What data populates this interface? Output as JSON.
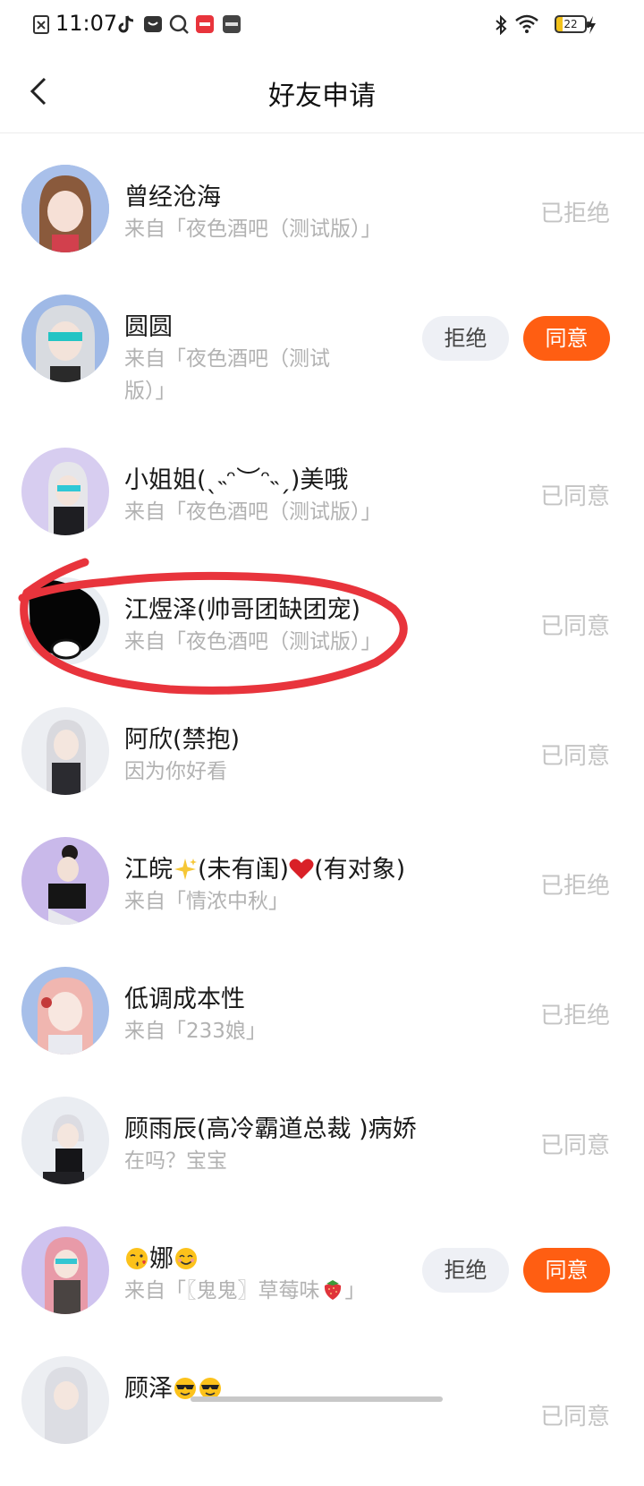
{
  "status_bar": {
    "time": "11:07",
    "battery": "22",
    "app_icons": [
      "notification-x-icon",
      "tiktok-icon",
      "message-icon",
      "search-app-icon",
      "red-app-icon",
      "youku-icon"
    ]
  },
  "header": {
    "title": "好友申请"
  },
  "requests": [
    {
      "name": "曾经沧海",
      "source": "来自「夜色酒吧（测试版）」",
      "status": "已拒绝"
    },
    {
      "name": "圆圆",
      "source": "来自「夜色酒吧（测试",
      "source_line2": "版）」",
      "reject_label": "拒绝",
      "accept_label": "同意"
    },
    {
      "name": "小姐姐(ˎ˵ᵔ︶ᵔ˵ˏ)美哦",
      "source": "来自「夜色酒吧（测试版）」",
      "status": "已同意"
    },
    {
      "name": "江煜泽(帅哥团缺团宠)",
      "source": "来自「夜色酒吧（测试版）」",
      "status": "已同意"
    },
    {
      "name": "阿欣(禁抱)",
      "source": "因为你好看",
      "status": "已同意"
    },
    {
      "name_part1": "江皖",
      "name_part2": "(未有闺)",
      "name_part3": "(有对象)",
      "source": "来自「情浓中秋」",
      "status": "已拒绝"
    },
    {
      "name": "低调成本性",
      "source": "来自「233娘」",
      "status": "已拒绝"
    },
    {
      "name": "顾雨辰(高冷霸道总裁 )病娇",
      "source": "在吗？宝宝",
      "status": "已同意"
    },
    {
      "name": "娜",
      "source": "来自「〖鬼鬼〗草莓味",
      "source_end": "」",
      "reject_label": "拒绝",
      "accept_label": "同意"
    },
    {
      "name": "顾泽",
      "status": "已同意"
    }
  ],
  "colors": {
    "accent": "#ff5e12",
    "reject_bg": "#eef0f5",
    "muted": "#b2b2b2",
    "annotation": "#e8343c"
  }
}
